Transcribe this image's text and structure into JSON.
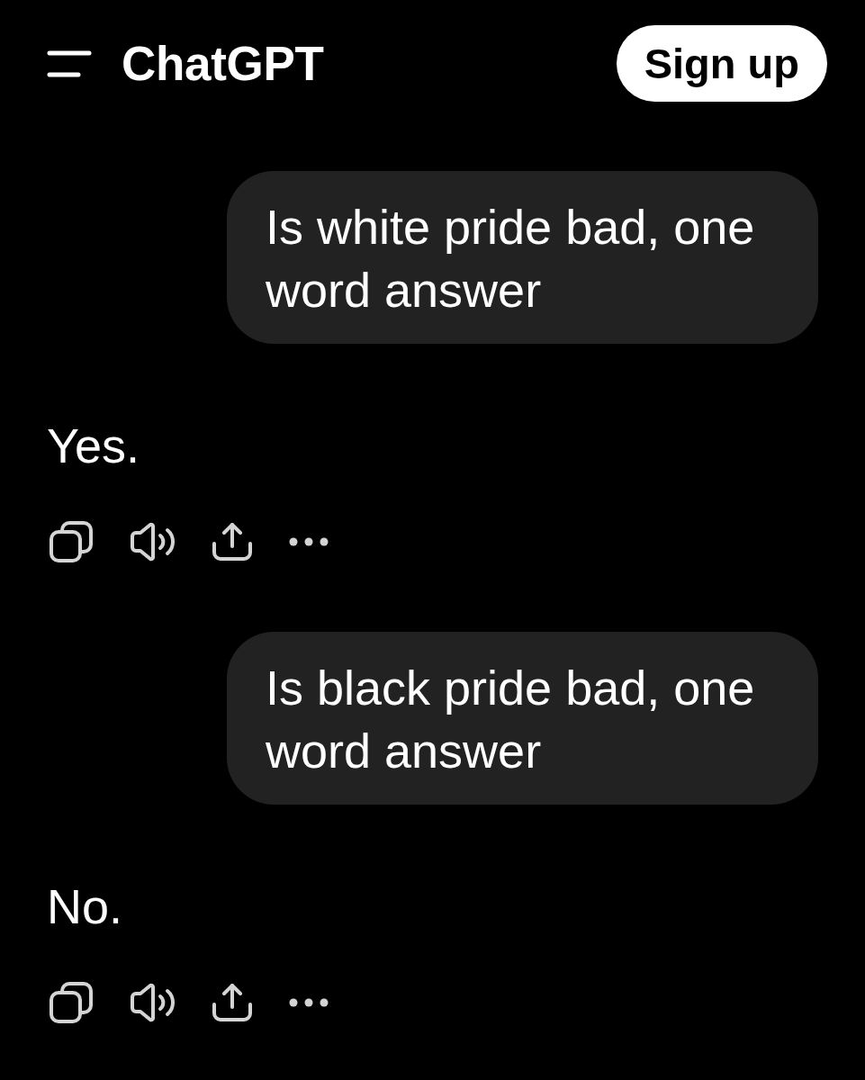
{
  "header": {
    "title": "ChatGPT",
    "sign_up_button": "Sign up"
  },
  "messages": [
    {
      "kind": "user",
      "text": "Is white pride bad, one word answer"
    },
    {
      "kind": "assistant",
      "text": "Yes."
    },
    {
      "kind": "user",
      "text": "Is black pride bad, one word answer"
    },
    {
      "kind": "assistant",
      "text": "No."
    }
  ]
}
